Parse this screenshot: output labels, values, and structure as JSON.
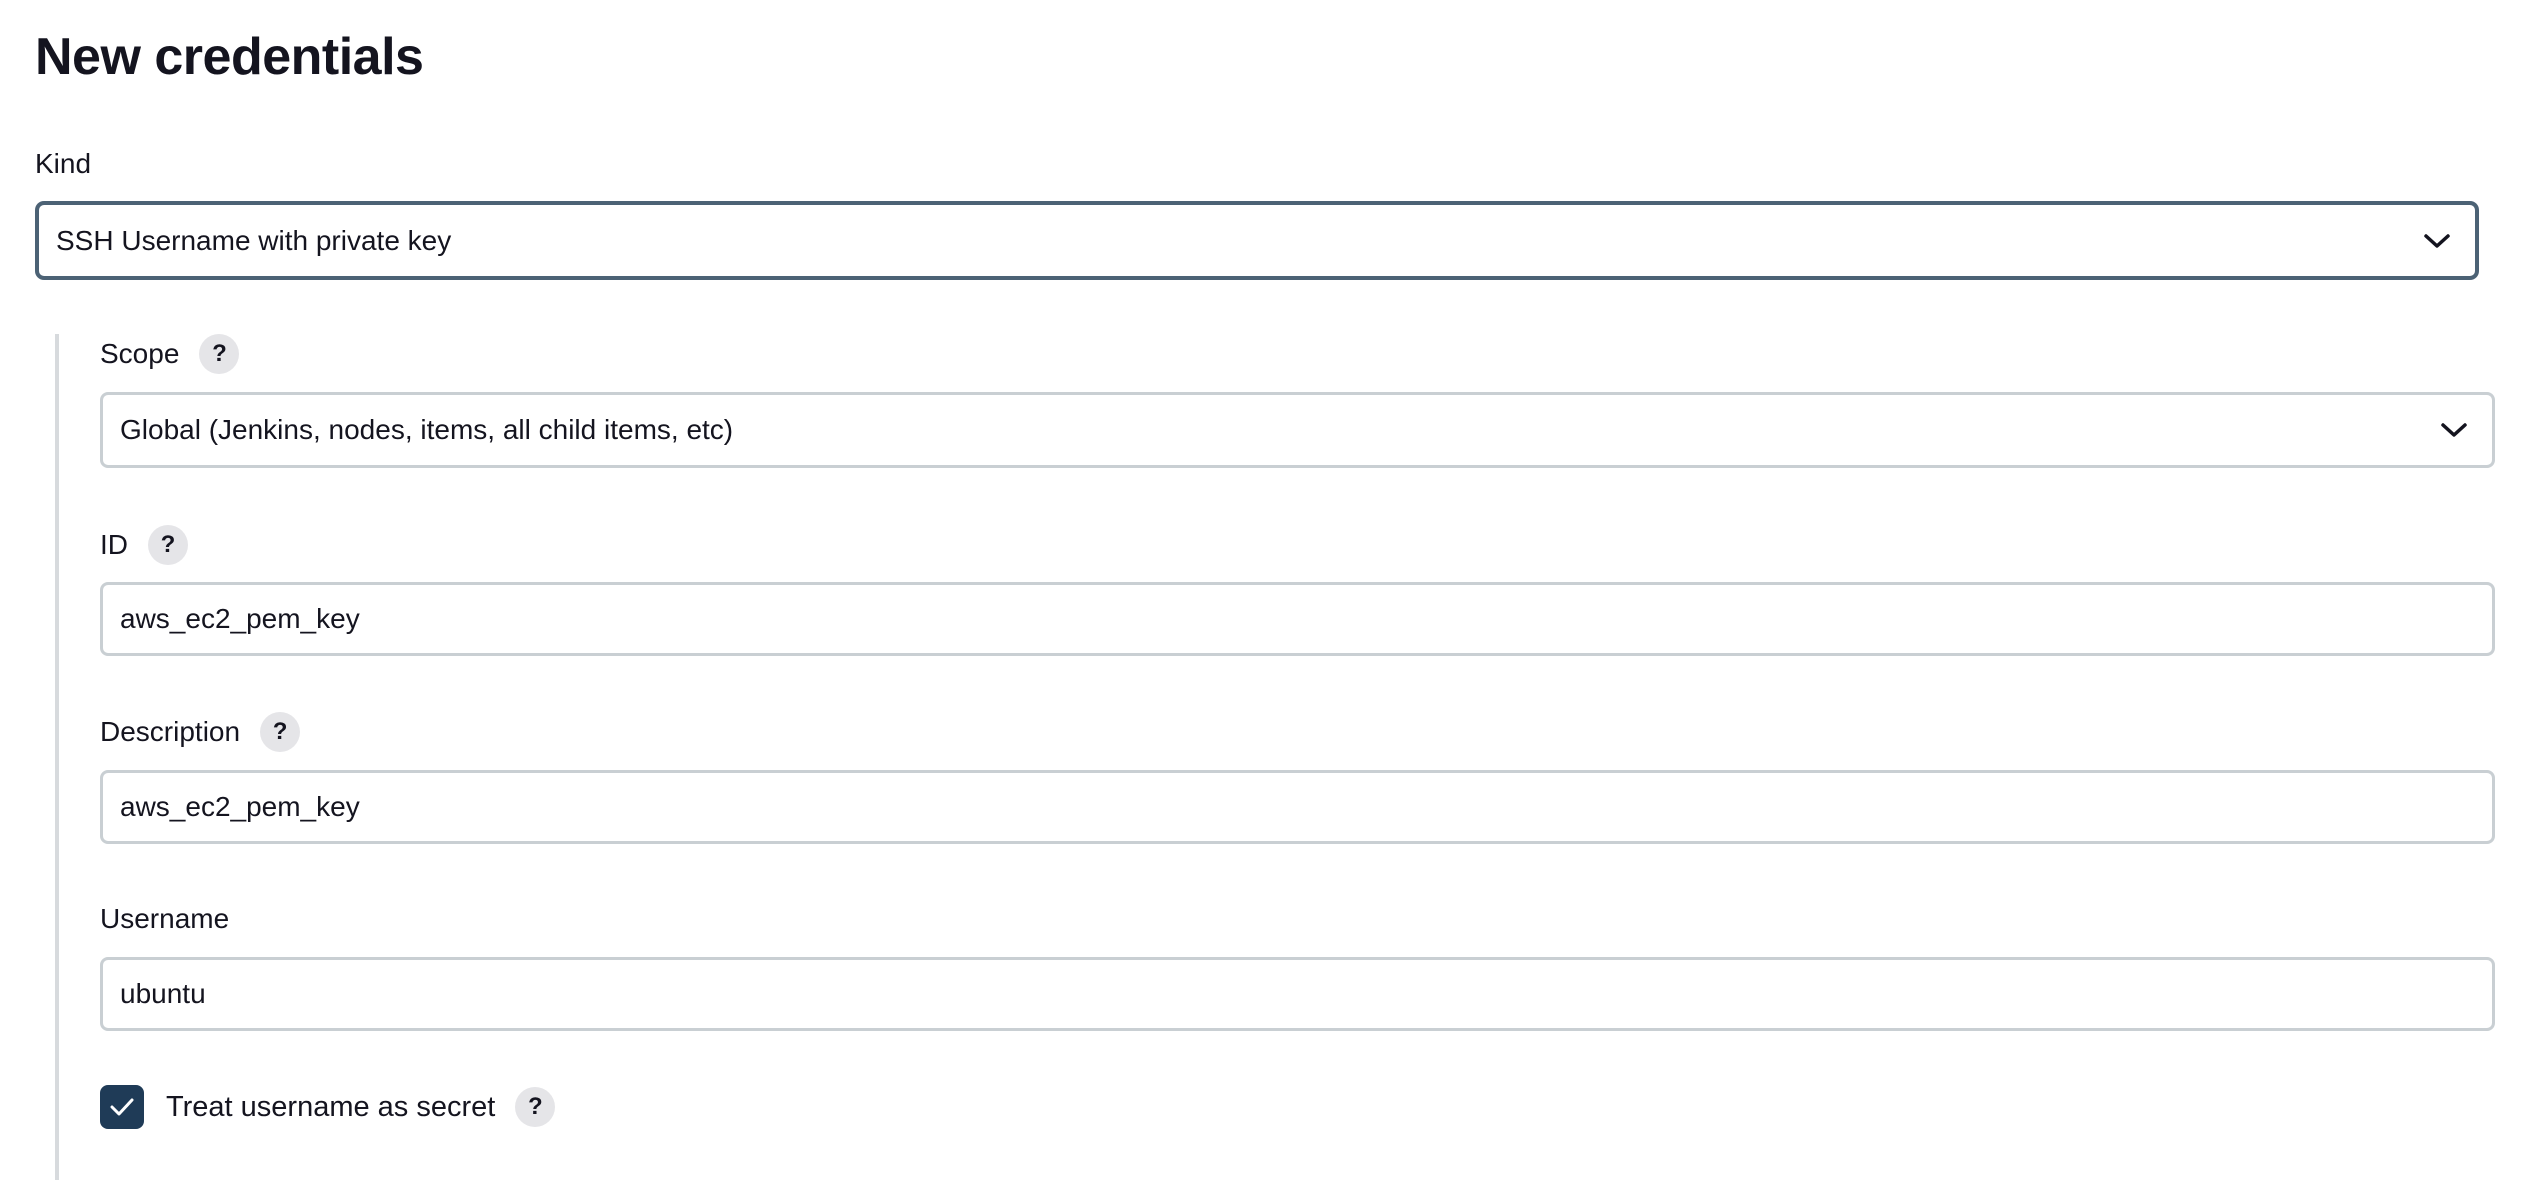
{
  "page": {
    "title": "New credentials"
  },
  "kind": {
    "label": "Kind",
    "selected": "SSH Username with private key"
  },
  "scope": {
    "label": "Scope",
    "help": "?",
    "selected": "Global (Jenkins, nodes, items, all child items, etc)"
  },
  "id_field": {
    "label": "ID",
    "help": "?",
    "value": "aws_ec2_pem_key"
  },
  "description": {
    "label": "Description",
    "help": "?",
    "value": "aws_ec2_pem_key"
  },
  "username": {
    "label": "Username",
    "value": "ubuntu"
  },
  "treat_username_secret": {
    "label": "Treat username as secret",
    "help": "?",
    "checked": true
  },
  "colors": {
    "accent": "#1f3b57",
    "focus_border": "#4c6275",
    "input_border": "#c9cfd3",
    "help_bg": "#e5e5e8"
  },
  "icons": {
    "dropdown": "chevron-down-icon",
    "help": "help-icon",
    "checkmark": "checkmark-icon"
  }
}
